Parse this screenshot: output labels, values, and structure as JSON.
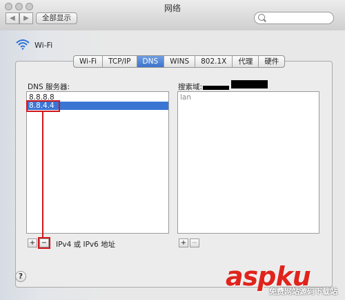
{
  "window": {
    "title": "网络"
  },
  "toolbar": {
    "back_glyph": "◀",
    "forward_glyph": "▶",
    "show_all_label": "全部显示",
    "search_placeholder": ""
  },
  "interface": {
    "name": "Wi-Fi",
    "icon": "wifi-icon"
  },
  "tabs": [
    {
      "label": "Wi-Fi"
    },
    {
      "label": "TCP/IP"
    },
    {
      "label": "DNS",
      "active": true
    },
    {
      "label": "WINS"
    },
    {
      "label": "802.1X"
    },
    {
      "label": "代理"
    },
    {
      "label": "硬件"
    }
  ],
  "dns": {
    "label": "DNS 服务器:",
    "servers": [
      "8.8.8.8",
      "8.8.4.4"
    ],
    "add_label": "+",
    "remove_label": "−",
    "hint": "IPv4 或 IPv6 地址"
  },
  "search_domains": {
    "label": "搜索域:",
    "items": [
      "lan"
    ],
    "add_label": "+",
    "remove_label": "−"
  },
  "help_label": "?",
  "watermark": {
    "brand": "aspku",
    "sub": "免费网站源码下载站"
  },
  "colors": {
    "selection": "#3b75d4",
    "annotation": "#d0161b",
    "active_tab": "#4a80d6"
  }
}
